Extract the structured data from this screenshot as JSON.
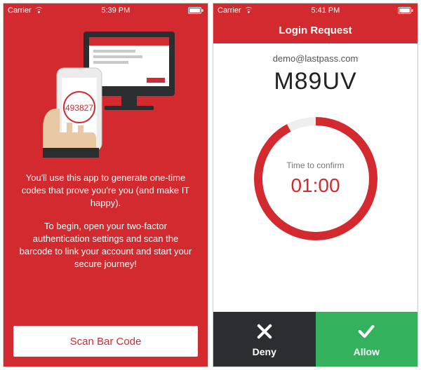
{
  "left": {
    "status": {
      "carrier": "Carrier",
      "time": "5:39 PM"
    },
    "hero_code": "493827",
    "intro_p1": "You'll use this app to generate one-time codes that prove you're you (and make IT happy).",
    "intro_p2": "To begin, open your two-factor authentication settings and scan the barcode to link your account and start your secure journey!",
    "scan_label": "Scan Bar Code"
  },
  "right": {
    "status": {
      "carrier": "Carrier",
      "time": "5:41 PM"
    },
    "header_title": "Login Request",
    "account": "demo@lastpass.com",
    "code": "M89UV",
    "timer_label": "Time to confirm",
    "timer_value": "01:00",
    "deny_label": "Deny",
    "allow_label": "Allow"
  },
  "colors": {
    "brand": "#d32a2f",
    "allow": "#34b15d",
    "deny": "#2b2e31"
  }
}
